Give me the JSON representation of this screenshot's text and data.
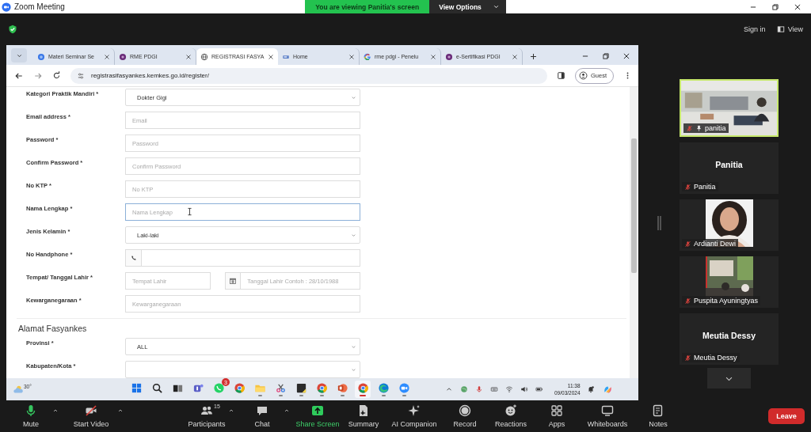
{
  "zoom_window": {
    "title": "Zoom Meeting",
    "banner": "You are viewing Panitia's screen",
    "view_options": "View Options",
    "sign_in": "Sign in",
    "view": "View"
  },
  "browser": {
    "tabs": [
      {
        "title": "Materi Seminar Se",
        "kind": "globe-blue",
        "selected": false
      },
      {
        "title": "RME PDGI",
        "kind": "dot",
        "selected": false
      },
      {
        "title": "REGISTRASI FASYA",
        "kind": "globe",
        "selected": true
      },
      {
        "title": "Home",
        "kind": "doc",
        "selected": false
      },
      {
        "title": "rme pdgi - Penelu",
        "kind": "google",
        "selected": false
      },
      {
        "title": "e-Sertifikasi PDGI",
        "kind": "dot",
        "selected": false
      }
    ],
    "url": "registrasifasyankes.kemkes.go.id/register/",
    "profile": "Guest"
  },
  "form": {
    "rows": [
      {
        "kind": "select",
        "label": "Kategori Praktik Mandiri *",
        "value": "Dokter Gigi"
      },
      {
        "kind": "input",
        "label": "Email address *",
        "placeholder": "Email",
        "focused": false
      },
      {
        "kind": "input",
        "label": "Password *",
        "placeholder": "Password",
        "focused": false
      },
      {
        "kind": "input",
        "label": "Confirm Password *",
        "placeholder": "Confirm Password",
        "focused": false
      },
      {
        "kind": "input",
        "label": "No KTP *",
        "placeholder": "No KTP",
        "focused": false
      },
      {
        "kind": "input",
        "label": "Nama Lengkap *",
        "placeholder": "Nama Lengkap",
        "focused": true
      },
      {
        "kind": "select",
        "label": "Jenis Kelamin *",
        "value": "Laki-laki"
      },
      {
        "kind": "phone",
        "label": "No Handphone *"
      },
      {
        "kind": "split",
        "label": "Tempat/ Tanggal Lahir *",
        "placeholder": "Tempat Lahir",
        "placeholder_2": "Tanggal Lahir Contoh : 28/10/1988"
      },
      {
        "kind": "input",
        "label": "Kewarganegaraan *",
        "placeholder": "Kewarganegaraan",
        "focused": false
      }
    ],
    "section": {
      "title": "Alamat Fasyankes",
      "rows": [
        {
          "kind": "select",
          "label": "Provinsi *",
          "value": "ALL"
        },
        {
          "kind": "select",
          "label": "Kabupaten/Kota *"
        }
      ]
    }
  },
  "taskbar": {
    "weather": "30°",
    "apps": [
      {
        "kind": "windows",
        "running": false
      },
      {
        "kind": "search",
        "running": false
      },
      {
        "kind": "taskview",
        "running": false
      },
      {
        "kind": "teams",
        "running": false
      },
      {
        "kind": "whatsapp",
        "running": false,
        "badge": "3"
      },
      {
        "kind": "chrome",
        "running": false
      },
      {
        "kind": "folder",
        "running": true
      },
      {
        "kind": "snip",
        "running": true
      },
      {
        "kind": "sticky",
        "running": true
      },
      {
        "kind": "chrome",
        "running": true
      },
      {
        "kind": "powerpoint",
        "running": true
      },
      {
        "kind": "chrome",
        "running": true,
        "active": true
      },
      {
        "kind": "edge",
        "running": true
      },
      {
        "kind": "zoom",
        "running": true
      }
    ],
    "tray": [
      {
        "kind": "caret"
      },
      {
        "kind": "globe"
      },
      {
        "kind": "mic"
      },
      {
        "kind": "keyboard"
      },
      {
        "kind": "wifi"
      },
      {
        "kind": "speaker"
      },
      {
        "kind": "battery"
      }
    ],
    "time": "11:38",
    "date": "09/03/2024"
  },
  "participants": {
    "tiles": [
      {
        "kind": "video",
        "name": "panitia",
        "muted": true,
        "pinned": true,
        "highlighted": true
      },
      {
        "kind": "name",
        "title": "Panitia",
        "name": "Panitia",
        "muted": true,
        "pinned": false,
        "highlighted": false
      },
      {
        "name": "Ardianti Dewi",
        "muted": true,
        "pinned": false,
        "highlighted": false
      },
      {
        "name": "Puspita Ayuningtyas",
        "muted": true,
        "pinned": false,
        "highlighted": false
      },
      {
        "kind": "name",
        "title": "Meutia Dessy",
        "name": "Meutia Dessy",
        "muted": true,
        "pinned": false,
        "highlighted": false
      }
    ]
  },
  "toolbar": {
    "buttons": [
      {
        "kind": "mic",
        "label": "Mute",
        "caret": true
      },
      {
        "kind": "video-off",
        "label": "Start Video",
        "caret": true
      },
      {
        "kind": "people",
        "label": "Participants",
        "count": "15",
        "caret": true
      },
      {
        "kind": "chat",
        "label": "Chat",
        "caret": true
      },
      {
        "kind": "share",
        "label": "Share Screen",
        "caret": false
      },
      {
        "kind": "summary",
        "label": "Summary",
        "caret": false
      },
      {
        "kind": "sparkle",
        "label": "AI Companion",
        "caret": false
      },
      {
        "kind": "record",
        "label": "Record",
        "caret": false
      },
      {
        "kind": "reactions",
        "label": "Reactions",
        "caret": false
      },
      {
        "kind": "apps",
        "label": "Apps",
        "caret": false
      },
      {
        "kind": "whiteboard",
        "label": "Whiteboards",
        "caret": false
      },
      {
        "kind": "notes",
        "label": "Notes",
        "caret": false
      }
    ],
    "leave": "Leave"
  }
}
